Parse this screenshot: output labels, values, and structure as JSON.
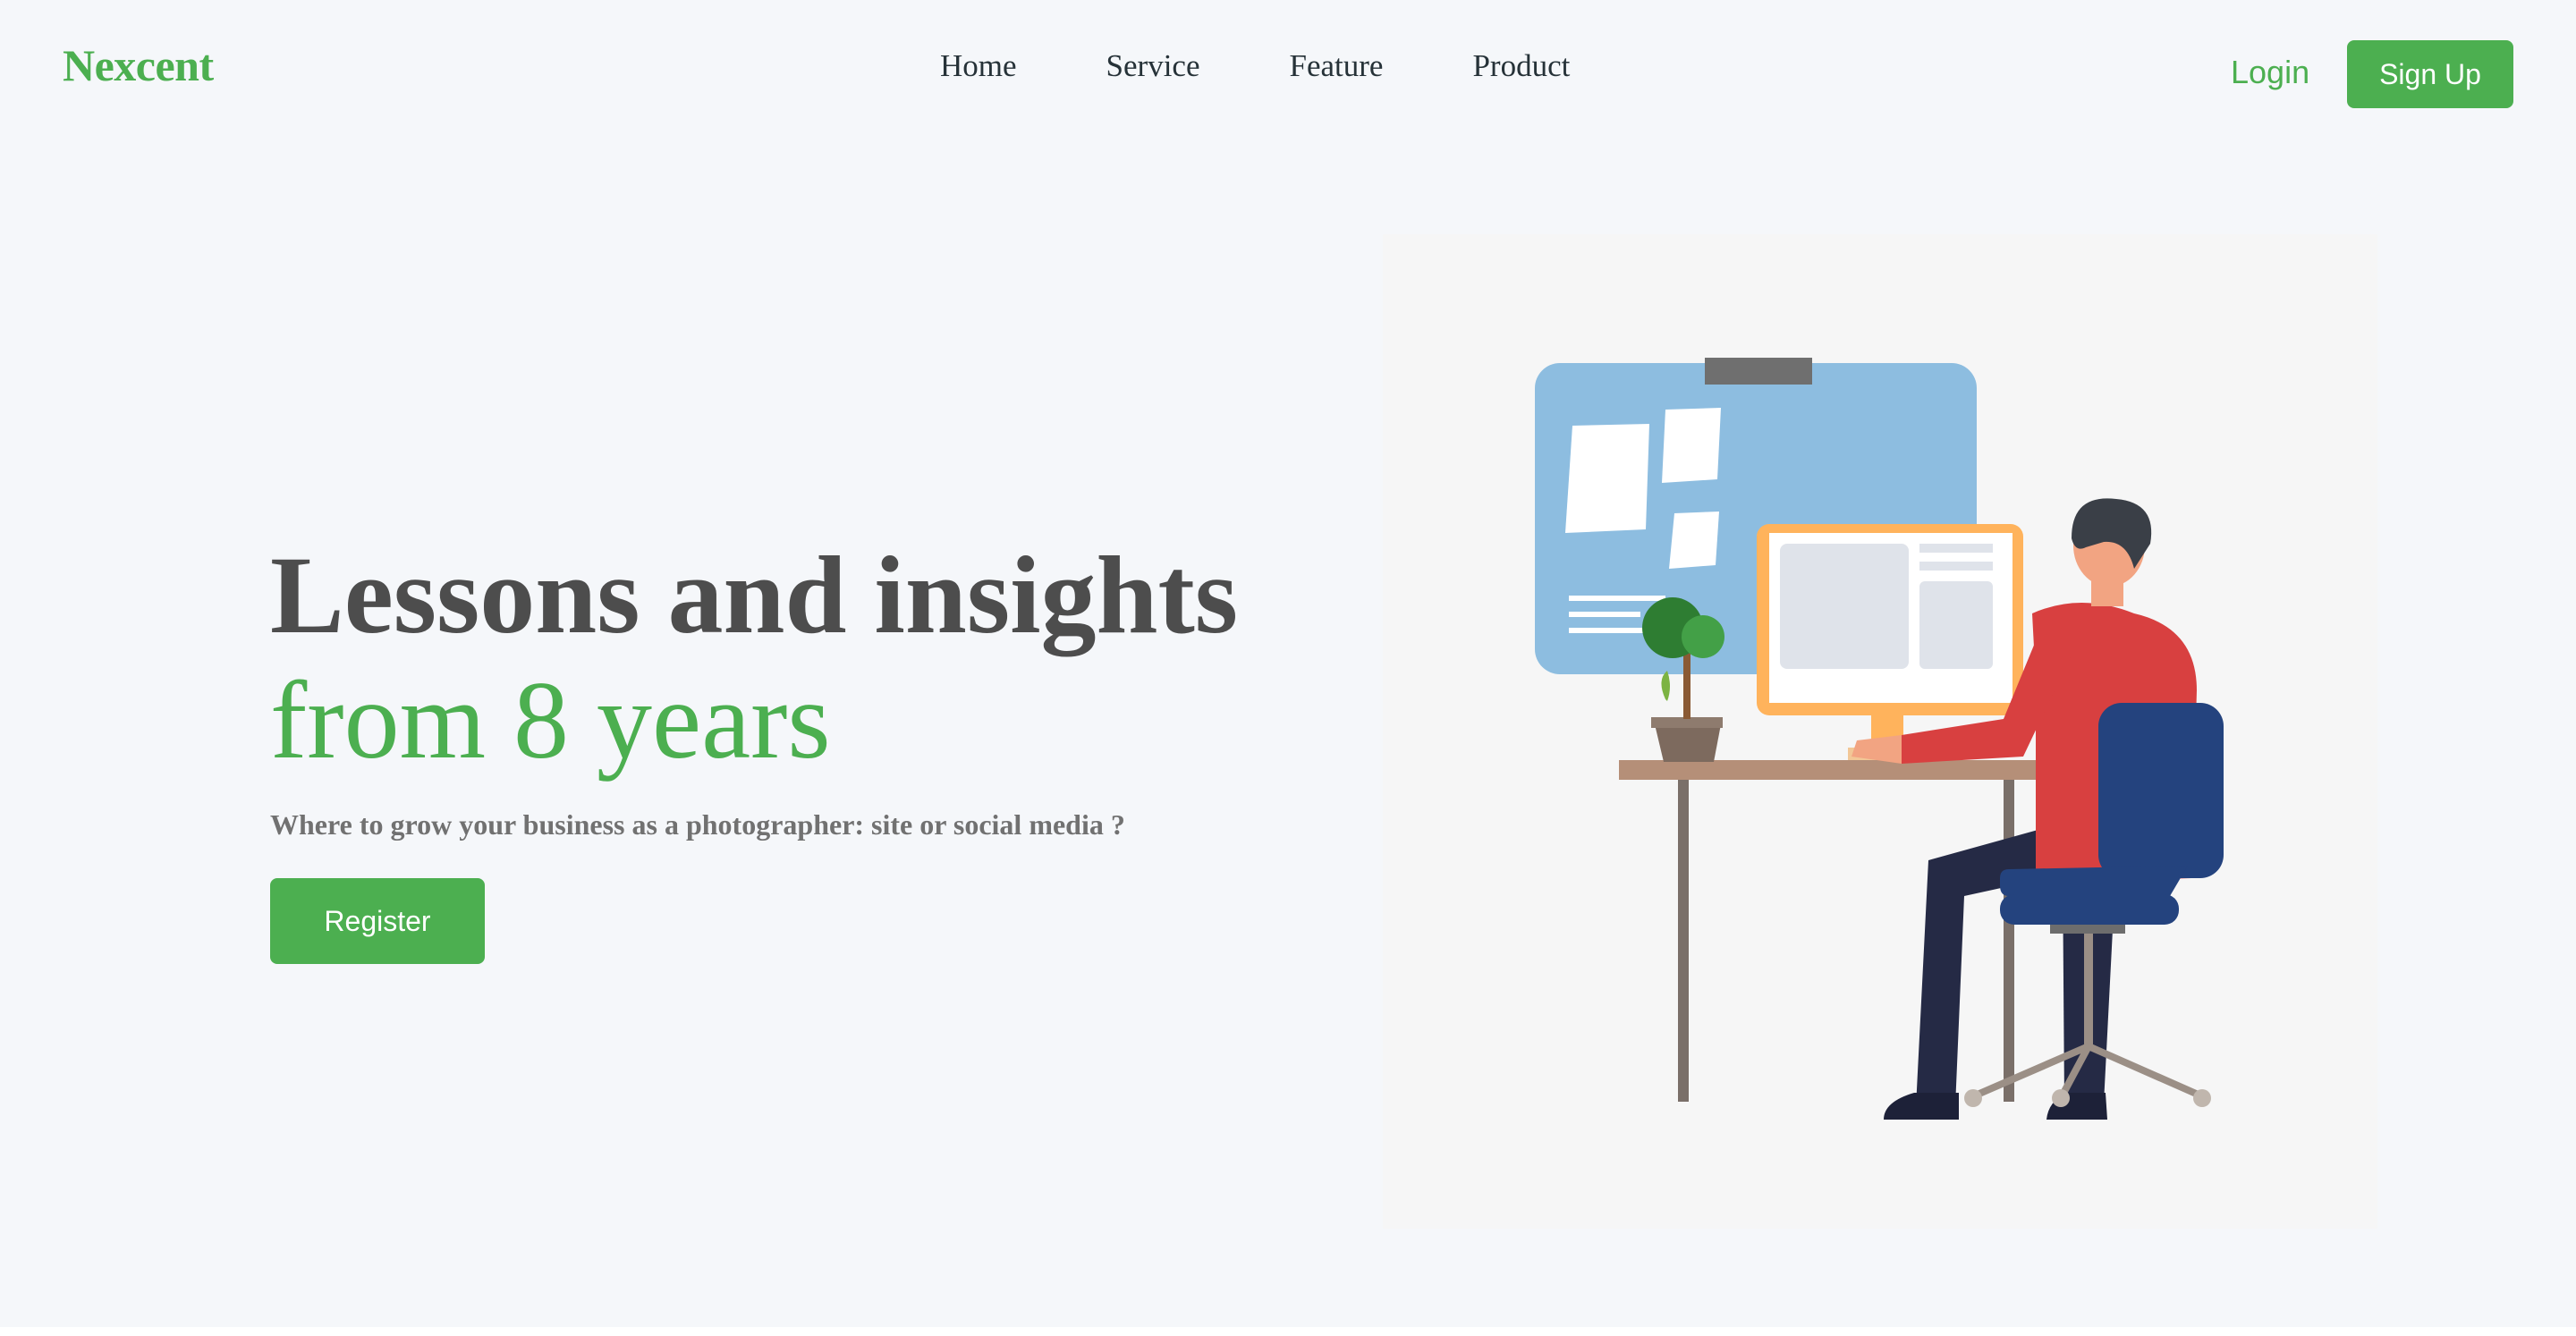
{
  "header": {
    "logo": "Nexcent",
    "nav": [
      "Home",
      "Service",
      "Feature",
      "Product"
    ],
    "login_label": "Login",
    "signup_label": "Sign Up"
  },
  "hero": {
    "title_line1": "Lessons and insights",
    "title_line2": "from 8 years",
    "subtitle": "Where to grow your business as a photographer: site or social media ?",
    "register_label": "Register"
  },
  "colors": {
    "brand": "#4caf50",
    "heading": "#4d4d4d",
    "body_text": "#717171",
    "background": "#f5f7fa"
  }
}
